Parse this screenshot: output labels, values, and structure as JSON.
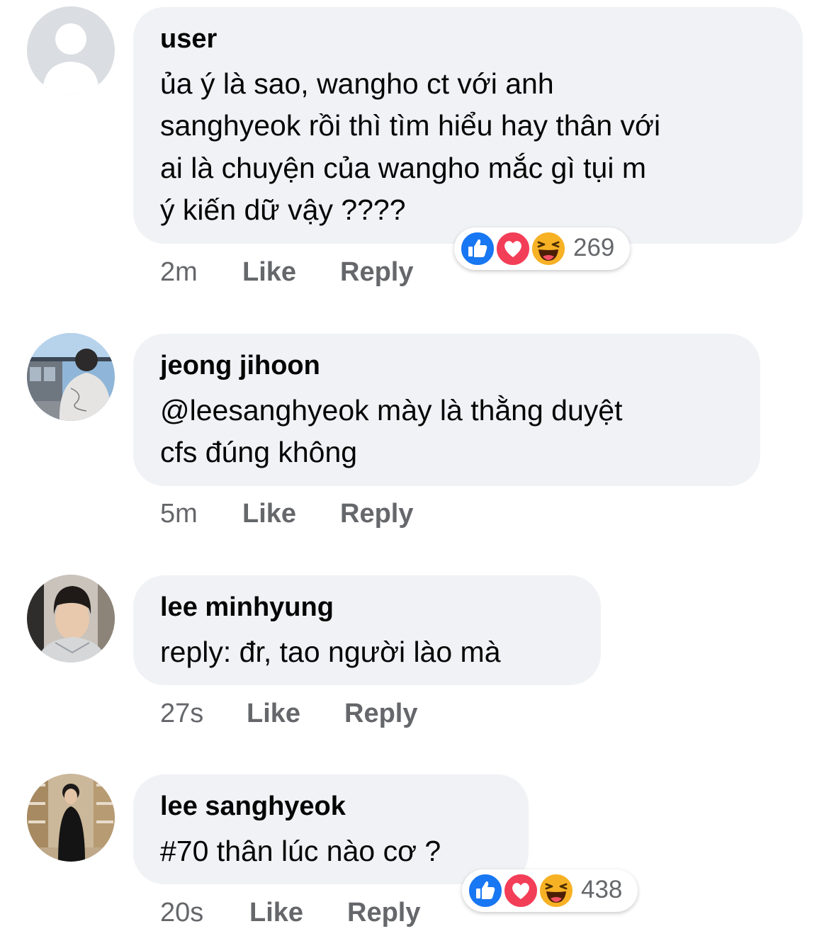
{
  "colors": {
    "bubble_bg": "#f0f2f5",
    "meta_text": "#65676b",
    "like_blue": "#1877f2",
    "love_red": "#f33e58",
    "haha_yellow": "#f7b125"
  },
  "comments": [
    {
      "author": "user",
      "lines": [
        "ủa ý là sao, wangho ct với anh",
        "sanghyeok rồi thì tìm hiểu hay thân với",
        "ai là chuyện của wangho mắc gì tụi m",
        "ý kiến dữ vậy ????"
      ],
      "time": "2m",
      "like_label": "Like",
      "reply_label": "Reply",
      "avatar": "default-avatar-icon",
      "reactions": {
        "icons": [
          "like-reaction-icon",
          "love-reaction-icon",
          "haha-reaction-icon"
        ],
        "count": "269"
      }
    },
    {
      "author": "jeong jihoon",
      "lines": [
        "@leesanghyeok mày là thằng duyệt",
        "cfs đúng không"
      ],
      "time": "5m",
      "like_label": "Like",
      "reply_label": "Reply",
      "avatar": "profile-photo"
    },
    {
      "author": "lee minhyung",
      "lines": [
        "reply: đr, tao người lào mà"
      ],
      "time": "27s",
      "like_label": "Like",
      "reply_label": "Reply",
      "avatar": "profile-photo"
    },
    {
      "author": "lee sanghyeok",
      "lines": [
        "#70 thân lúc nào cơ ?"
      ],
      "time": "20s",
      "like_label": "Like",
      "reply_label": "Reply",
      "avatar": "profile-photo",
      "reactions": {
        "icons": [
          "like-reaction-icon",
          "love-reaction-icon",
          "haha-reaction-icon"
        ],
        "count": "438"
      }
    }
  ]
}
